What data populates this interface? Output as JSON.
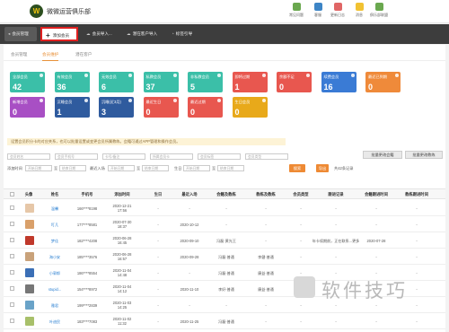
{
  "brand": {
    "logo_letter": "W",
    "name": "微微运营俱乐部"
  },
  "topnav": [
    {
      "label": "常见问题",
      "color": "#6aa84f"
    },
    {
      "label": "客服",
      "color": "#3d85c6"
    },
    {
      "label": "更新日志",
      "color": "#e06666"
    },
    {
      "label": "消息",
      "color": "#f1c232"
    },
    {
      "label": "俱乐部联盟",
      "color": "#6aa84f"
    }
  ],
  "toolbar": {
    "back": "会员管理",
    "add": "添加会员",
    "import": "会员导入...",
    "import2": "潜在客户导入",
    "export": "标签引导"
  },
  "tabs": [
    "会员管理",
    "会员维护",
    "潜在客户"
  ],
  "tiles": [
    {
      "label": "全部会员",
      "value": "42",
      "color": "#3bbfa8"
    },
    {
      "label": "有效会员",
      "value": "36",
      "color": "#3bbfa8"
    },
    {
      "label": "无效会员",
      "value": "6",
      "color": "#3bbfa8"
    },
    {
      "label": "私教会员",
      "value": "37",
      "color": "#3bbfa8"
    },
    {
      "label": "非私教会员",
      "value": "5",
      "color": "#3bbfa8"
    },
    {
      "label": "即将过期",
      "value": "1",
      "color": "#e8574f"
    },
    {
      "label": "余额不足",
      "value": "0",
      "color": "#e8574f"
    },
    {
      "label": "续费会员",
      "value": "16",
      "color": "#3a7bd5"
    },
    {
      "label": "最近已到期",
      "value": "0",
      "color": "#ef8a3a"
    },
    {
      "label": "新增会员",
      "value": "0",
      "color": "#a84fc4"
    },
    {
      "label": "沉睡会员",
      "value": "1",
      "color": "#2f5b9e"
    },
    {
      "label": "沉睡(近3月)",
      "value": "3",
      "color": "#2f5b9e"
    },
    {
      "label": "最近生日",
      "value": "0",
      "color": "#e8574f"
    },
    {
      "label": "最近过期",
      "value": "0",
      "color": "#e8574f"
    },
    {
      "label": "生日会员",
      "value": "0",
      "color": "#e8a91a"
    }
  ],
  "notice": "设置会员积分卡的对应关系，也可以批量设置或变更会员所属教练。会籍可通过APP管理和操作会员。",
  "buttons": {
    "batch_member": "批量更改会籍",
    "batch_coach": "批量更改教练"
  },
  "filters": {
    "name": "会员姓名",
    "phone": "会员手机号",
    "cardno": "卡号/备注",
    "card": "所属会员卡",
    "tag": "会员标签",
    "type": "会员类型",
    "add_time_label": "添加时间",
    "start": "开始日期",
    "end": "结束日期",
    "enter_label": "最近入场",
    "birthday_label": "生日",
    "search": "搜索",
    "reset": "导出",
    "total": "共42条记录"
  },
  "columns": [
    "头像",
    "姓名",
    "手机号",
    "添加时间",
    "生日",
    "最近入场",
    "会籍及教练",
    "教练及教练",
    "会员类型",
    "跟进记录",
    "会籍跟进时间",
    "教练跟进时间"
  ],
  "rows": [
    {
      "name": "温馨",
      "phone": "166****8198",
      "added": "2020-12-21\n17:56",
      "birthday": "-",
      "enter": "-",
      "membership": "-",
      "coach": "-",
      "type": "-",
      "follow": "-",
      "mt": "-",
      "ct": "-",
      "color": "#e6c7a8"
    },
    {
      "name": "叮几",
      "phone": "177****8581",
      "added": "2020-07-30\n18:37",
      "birthday": "-",
      "enter": "2020-10-12",
      "membership": "-",
      "coach": "-",
      "type": "-",
      "follow": "-",
      "mt": "-",
      "ct": "-",
      "color": "#d9a06a"
    },
    {
      "name": "梦佳",
      "phone": "182****4208",
      "added": "2020-06-28\n16:45",
      "birthday": "-",
      "enter": "2020-09-10",
      "membership": "冯磊·黄光王",
      "coach": "-",
      "type": "-",
      "follow": "年卡续期前，正在联系...更多",
      "mt": "2020-07-28",
      "ct": "-",
      "color": "#c0392b"
    },
    {
      "name": "海小安",
      "phone": "185****3576",
      "added": "2020-06-28\n16:57",
      "birthday": "-",
      "enter": "2020-09-28",
      "membership": "冯磊·普通",
      "coach": "李健·普通",
      "type": "-",
      "follow": "-",
      "mt": "-",
      "ct": "-",
      "color": "#c9a27a"
    },
    {
      "name": "小郭郎",
      "phone": "186****8554",
      "added": "2020-11-04\n14:48",
      "birthday": "-",
      "enter": "-",
      "membership": "冯磊·普通",
      "coach": "康益·普通",
      "type": "-",
      "follow": "-",
      "mt": "-",
      "ct": "-",
      "color": "#3b6fb6"
    },
    {
      "name": "stupid...",
      "phone": "154****8972",
      "added": "2020-11-04\n14:12",
      "birthday": "-",
      "enter": "2020-11-10",
      "membership": "李好·普通",
      "coach": "康益·普通",
      "type": "-",
      "follow": "-",
      "mt": "-",
      "ct": "-",
      "color": "#777777"
    },
    {
      "name": "雅君",
      "phone": "199****2839",
      "added": "2020-11-03\n14:25",
      "birthday": "-",
      "enter": "-",
      "membership": "-",
      "coach": "-",
      "type": "-",
      "follow": "-",
      "mt": "-",
      "ct": "-",
      "color": "#6aa3c8"
    },
    {
      "name": "叶迪民",
      "phone": "183****7083",
      "added": "2020-11-02\n11:32",
      "birthday": "-",
      "enter": "2020-11-25",
      "membership": "冯磊·普通",
      "coach": "-",
      "type": "-",
      "follow": "-",
      "mt": "-",
      "ct": "-",
      "color": "#a8c06a"
    }
  ],
  "watermark": "软件技巧"
}
